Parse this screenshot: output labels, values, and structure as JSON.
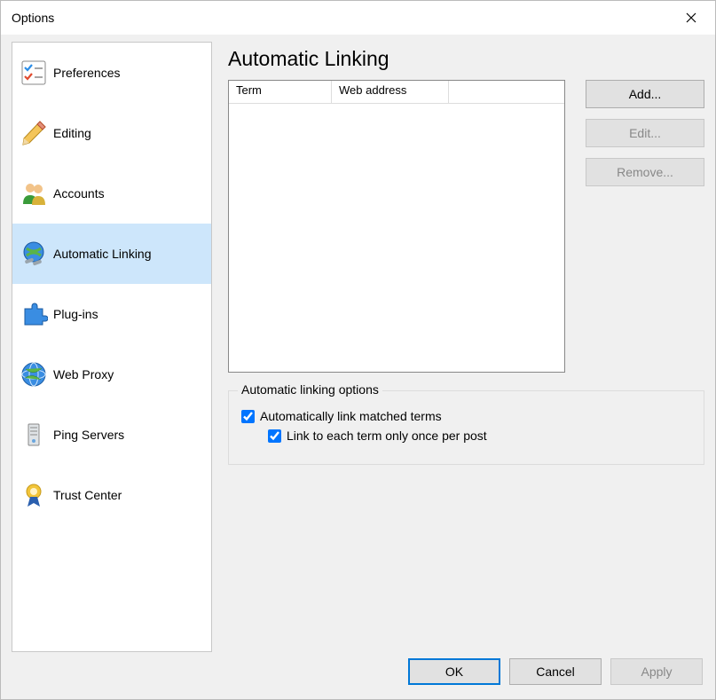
{
  "window": {
    "title": "Options"
  },
  "sidebar": {
    "items": [
      {
        "label": "Preferences",
        "icon": "preferences"
      },
      {
        "label": "Editing",
        "icon": "editing"
      },
      {
        "label": "Accounts",
        "icon": "accounts"
      },
      {
        "label": "Automatic Linking",
        "icon": "autolink",
        "selected": true
      },
      {
        "label": "Plug-ins",
        "icon": "plugins"
      },
      {
        "label": "Web Proxy",
        "icon": "proxy"
      },
      {
        "label": "Ping Servers",
        "icon": "ping"
      },
      {
        "label": "Trust Center",
        "icon": "trust"
      }
    ]
  },
  "page": {
    "heading": "Automatic Linking",
    "table": {
      "columns": [
        "Term",
        "Web address"
      ],
      "rows": []
    },
    "buttons": {
      "add": "Add...",
      "edit": "Edit...",
      "remove": "Remove..."
    },
    "group": {
      "legend": "Automatic linking options",
      "auto_link": {
        "checked": true,
        "label": "Automatically link matched terms"
      },
      "once_per_post": {
        "checked": true,
        "label": "Link to each term only once per post"
      }
    }
  },
  "footer": {
    "ok": "OK",
    "cancel": "Cancel",
    "apply": "Apply"
  }
}
